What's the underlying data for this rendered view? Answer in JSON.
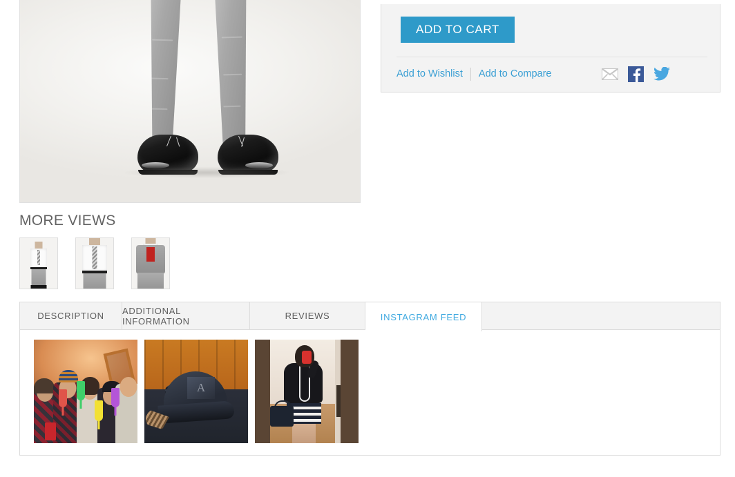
{
  "gallery": {
    "main_image_alt": "Grey trousers and black dress shoes product photo",
    "more_views_title": "MORE VIEWS",
    "thumbnails": [
      {
        "alt": "White shirt with grey trousers full view"
      },
      {
        "alt": "White shirt with striped tie closeup"
      },
      {
        "alt": "Grey suit jacket with red vest"
      }
    ]
  },
  "buy_box": {
    "add_to_cart_label": "ADD TO CART",
    "wishlist_label": "Add to Wishlist",
    "compare_label": "Add to Compare",
    "social": [
      {
        "name": "email-icon",
        "title": "Email"
      },
      {
        "name": "facebook-icon",
        "title": "Facebook",
        "color": "#3b5998"
      },
      {
        "name": "twitter-icon",
        "title": "Twitter",
        "color": "#4aa7e0"
      }
    ]
  },
  "tabs": {
    "items": [
      {
        "label": "DESCRIPTION",
        "active": false
      },
      {
        "label": "ADDITIONAL INFORMATION",
        "active": false
      },
      {
        "label": "REVIEWS",
        "active": false
      },
      {
        "label": "INSTAGRAM FEED",
        "active": true
      }
    ],
    "active_color": "#3fa9e0",
    "inactive_color": "#5d5d5d"
  },
  "instagram_feed": {
    "posts": [
      {
        "alt": "Group of five friends holding colorful plastic champagne glasses"
      },
      {
        "alt": "Dark blue baseball cap with leather patch on a wooden table"
      },
      {
        "alt": "Mirror selfie of woman in black top and striped skirt holding handbag"
      }
    ]
  },
  "colors": {
    "accent_blue": "#2e9ac9",
    "link_blue": "#3a9fd4",
    "panel_bg": "#f3f3f3",
    "border": "#dcdcdc",
    "heading": "#636363"
  }
}
